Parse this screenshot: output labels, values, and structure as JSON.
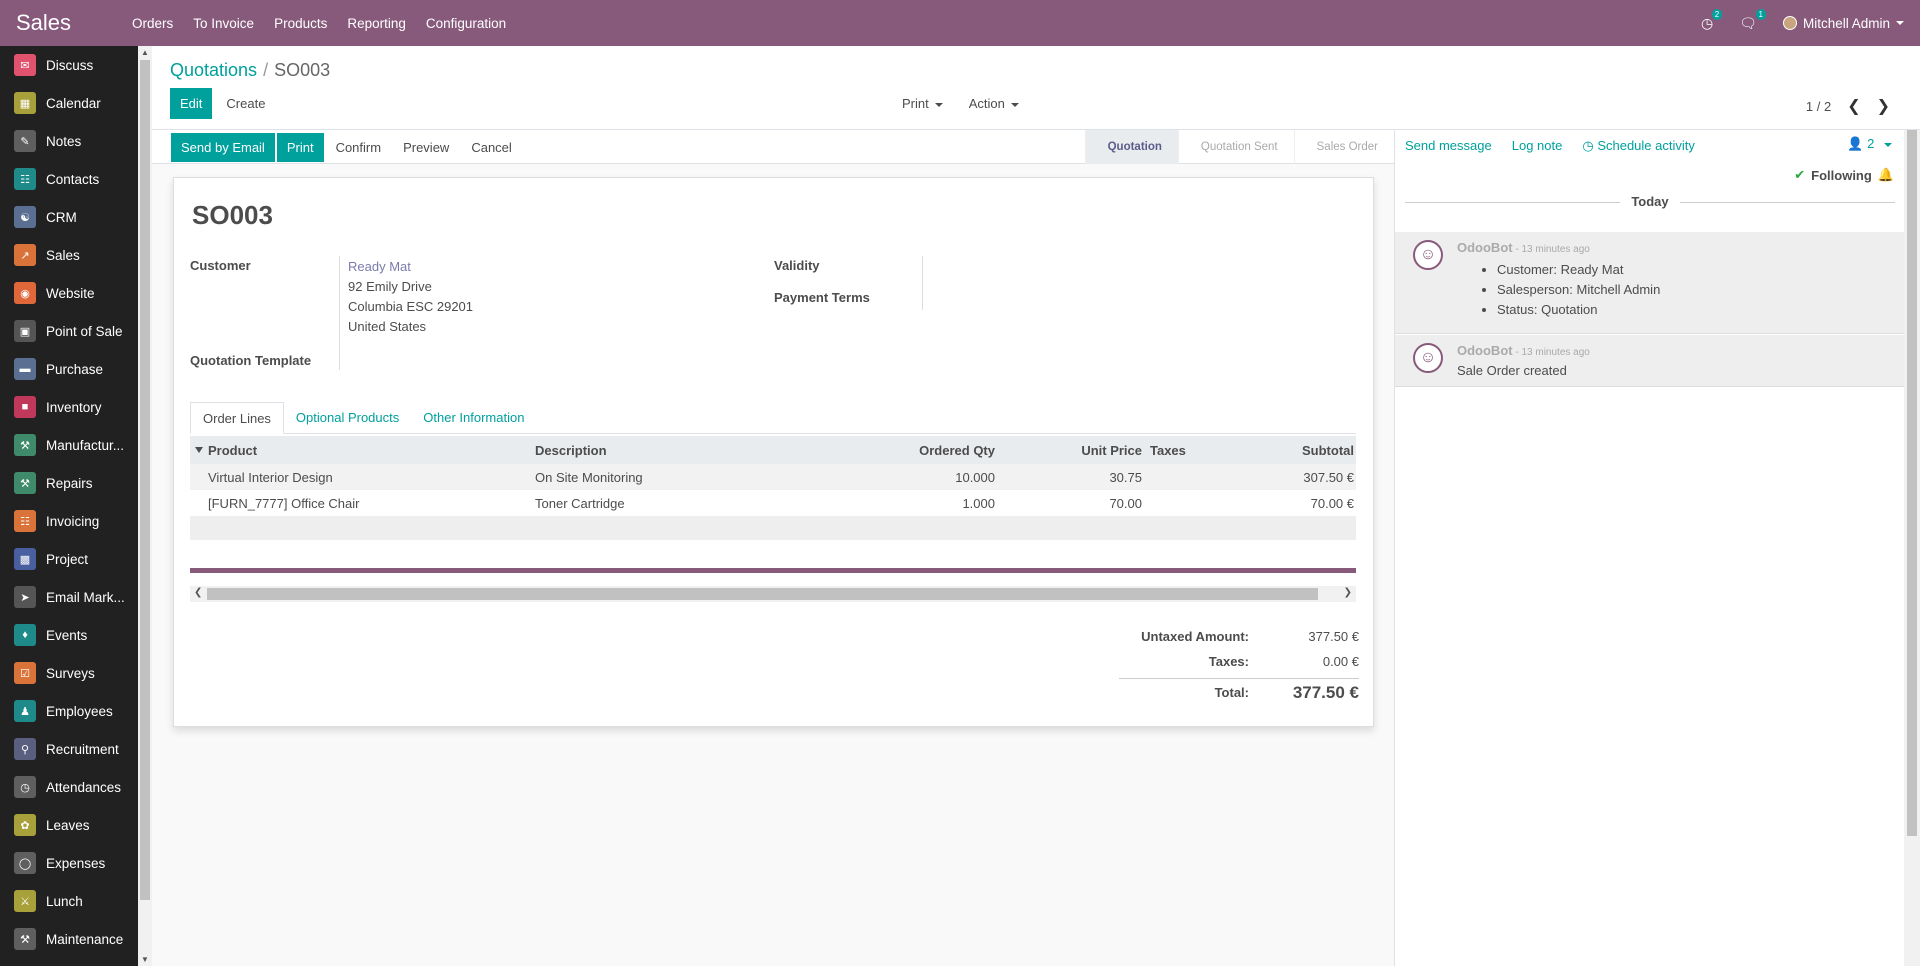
{
  "topbar": {
    "brand": "Sales",
    "menu": [
      "Orders",
      "To Invoice",
      "Products",
      "Reporting",
      "Configuration"
    ],
    "activity_count": "2",
    "message_count": "1",
    "user": "Mitchell Admin"
  },
  "sidebar": {
    "items": [
      {
        "label": "Discuss",
        "icon": "chat-icon",
        "color": "#e0526e"
      },
      {
        "label": "Calendar",
        "icon": "calendar-icon",
        "color": "#a8a13b"
      },
      {
        "label": "Notes",
        "icon": "notes-icon",
        "color": "#5f5f5f"
      },
      {
        "label": "Contacts",
        "icon": "contacts-icon",
        "color": "#1f8a8a"
      },
      {
        "label": "CRM",
        "icon": "handshake-icon",
        "color": "#5a6f92"
      },
      {
        "label": "Sales",
        "icon": "chart-icon",
        "color": "#d9733a"
      },
      {
        "label": "Website",
        "icon": "globe-icon",
        "color": "#e0673a"
      },
      {
        "label": "Point of Sale",
        "icon": "store-icon",
        "color": "#555555"
      },
      {
        "label": "Purchase",
        "icon": "credit-card-icon",
        "color": "#5a6f92"
      },
      {
        "label": "Inventory",
        "icon": "box-icon",
        "color": "#c0395a"
      },
      {
        "label": "Manufactur...",
        "icon": "wrench-icon",
        "color": "#3f8a6a"
      },
      {
        "label": "Repairs",
        "icon": "tools-icon",
        "color": "#3f8a6a"
      },
      {
        "label": "Invoicing",
        "icon": "invoice-icon",
        "color": "#d9733a"
      },
      {
        "label": "Project",
        "icon": "puzzle-icon",
        "color": "#4a5fa0"
      },
      {
        "label": "Email Mark...",
        "icon": "paper-plane-icon",
        "color": "#555555"
      },
      {
        "label": "Events",
        "icon": "ticket-icon",
        "color": "#1f8a8a"
      },
      {
        "label": "Surveys",
        "icon": "survey-icon",
        "color": "#d9733a"
      },
      {
        "label": "Employees",
        "icon": "users-icon",
        "color": "#1f8a8a"
      },
      {
        "label": "Recruitment",
        "icon": "search-user-icon",
        "color": "#5a5f80"
      },
      {
        "label": "Attendances",
        "icon": "clock-user-icon",
        "color": "#5f5f5f"
      },
      {
        "label": "Leaves",
        "icon": "leaf-icon",
        "color": "#a8a13b"
      },
      {
        "label": "Expenses",
        "icon": "coins-icon",
        "color": "#5f5f5f"
      },
      {
        "label": "Lunch",
        "icon": "cutlery-icon",
        "color": "#a8a13b"
      },
      {
        "label": "Maintenance",
        "icon": "hammer-icon",
        "color": "#5f5f5f"
      }
    ]
  },
  "control_panel": {
    "breadcrumb_parent": "Quotations",
    "breadcrumb_sep": "/",
    "breadcrumb_current": "SO003",
    "edit_label": "Edit",
    "create_label": "Create",
    "print_label": "Print",
    "action_label": "Action",
    "pager": "1 / 2"
  },
  "statusbar": {
    "send_email_label": "Send by Email",
    "print_label": "Print",
    "confirm_label": "Confirm",
    "preview_label": "Preview",
    "cancel_label": "Cancel",
    "stages": [
      "Quotation",
      "Quotation Sent",
      "Sales Order"
    ]
  },
  "form": {
    "title": "SO003",
    "customer_label": "Customer",
    "customer_name": "Ready Mat",
    "address_line1": "92 Emily Drive",
    "address_line2": "Columbia ESC 29201",
    "address_line3": "United States",
    "quotation_template_label": "Quotation Template",
    "validity_label": "Validity",
    "payment_terms_label": "Payment Terms",
    "tabs": [
      "Order Lines",
      "Optional Products",
      "Other Information"
    ],
    "table": {
      "headers": [
        "Product",
        "Description",
        "Ordered Qty",
        "Unit Price",
        "Taxes",
        "Subtotal"
      ],
      "rows": [
        [
          "Virtual Interior Design",
          "On Site Monitoring",
          "10.000",
          "30.75",
          "",
          "307.50 €"
        ],
        [
          "[FURN_7777] Office Chair",
          "Toner Cartridge",
          "1.000",
          "70.00",
          "",
          "70.00 €"
        ]
      ]
    },
    "totals": {
      "untaxed_label": "Untaxed Amount:",
      "untaxed_value": "377.50 €",
      "taxes_label": "Taxes:",
      "taxes_value": "0.00 €",
      "total_label": "Total:",
      "total_value": "377.50 €"
    }
  },
  "chatter": {
    "send_message": "Send message",
    "log_note": "Log note",
    "schedule_activity": "Schedule activity",
    "followers_count": "2",
    "following": "Following",
    "today": "Today",
    "messages": [
      {
        "author": "OdooBot",
        "time": " - 13 minutes ago",
        "items": [
          "Customer: Ready Mat",
          "Salesperson: Mitchell Admin",
          "Status: Quotation"
        ]
      },
      {
        "author": "OdooBot",
        "time": " - 13 minutes ago",
        "body": "Sale Order created"
      }
    ]
  },
  "colors": {
    "brand": "#875a7b",
    "primary": "#00a09d"
  }
}
